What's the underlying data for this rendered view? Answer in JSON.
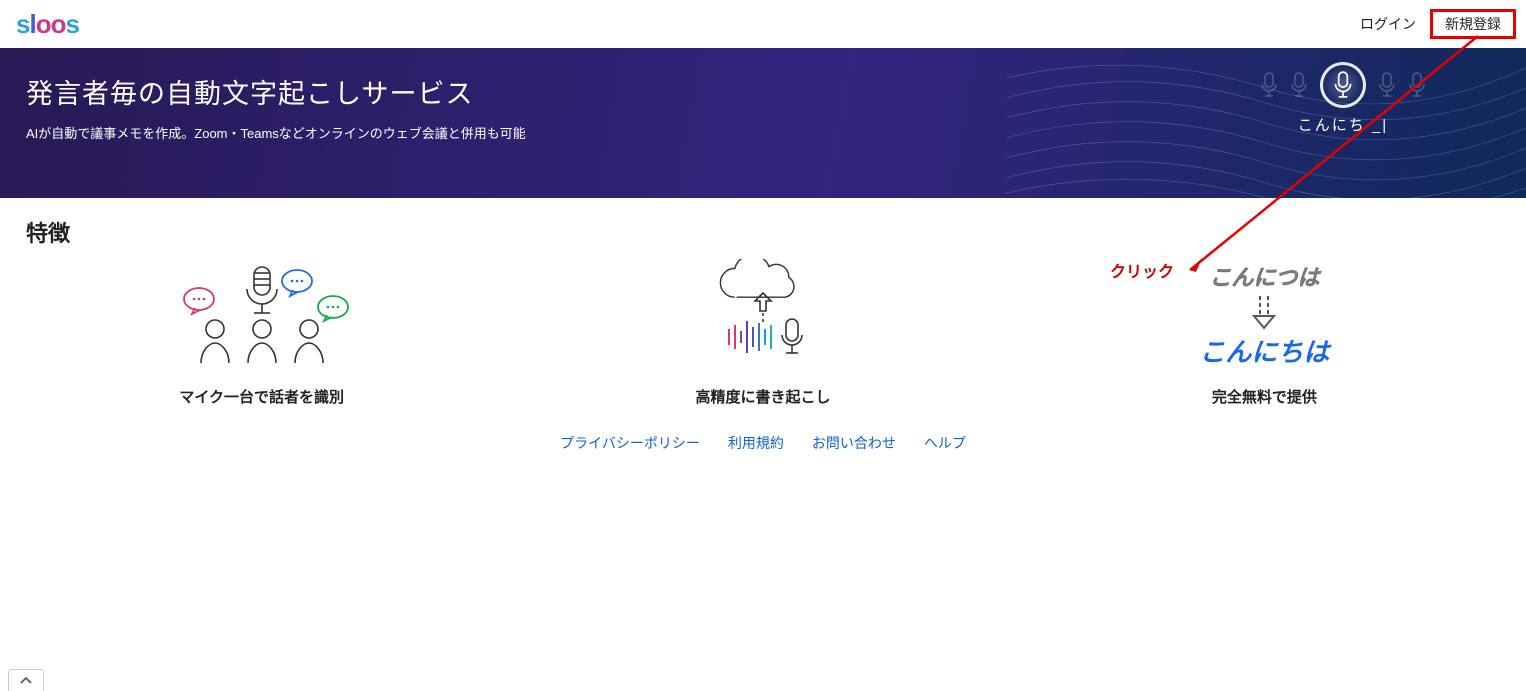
{
  "header": {
    "logo_letters": [
      "s",
      "l",
      "o",
      "o",
      "s"
    ],
    "login_label": "ログイン",
    "signup_label": "新規登録"
  },
  "hero": {
    "title": "発言者毎の自動文字起こしサービス",
    "subtitle": "AIが自動で議事メモを作成。Zoom・Teamsなどオンラインのウェブ会議と併用も可能",
    "typing_text": "こんにち _|"
  },
  "features": {
    "heading": "特徴",
    "items": [
      {
        "caption": "マイク一台で話者を識別"
      },
      {
        "caption": "高精度に書き起こし"
      },
      {
        "caption": "完全無料で提供",
        "demo_wrong": "こんにつは",
        "demo_right": "こんにちは"
      }
    ]
  },
  "footer": {
    "links": [
      "プライバシーポリシー",
      "利用規約",
      "お問い合わせ",
      "ヘルプ"
    ]
  },
  "annotation": {
    "click_label": "クリック"
  }
}
